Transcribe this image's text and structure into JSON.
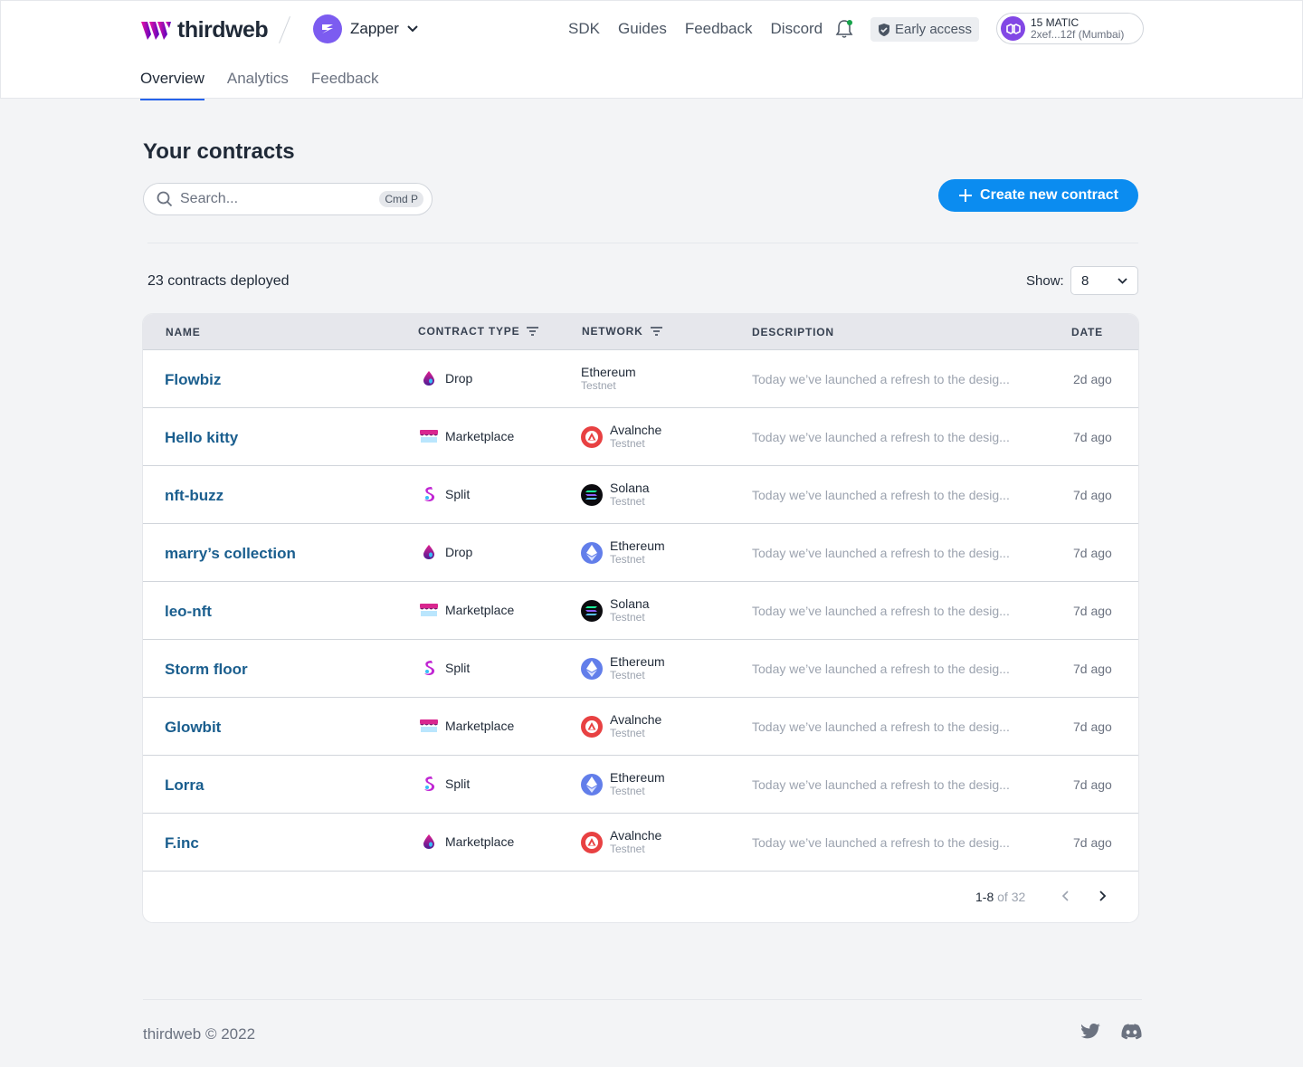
{
  "brand": {
    "name": "thirdweb",
    "accent": "#0b8cf0",
    "logo_color": "#c026d3"
  },
  "project": {
    "name": "Zapper"
  },
  "topnav": [
    {
      "label": "SDK"
    },
    {
      "label": "Guides"
    },
    {
      "label": "Feedback"
    },
    {
      "label": "Discord"
    }
  ],
  "badge": {
    "label": "Early access"
  },
  "wallet": {
    "amount": "15 MATIC",
    "address": "2xef...12f (Mumbai)"
  },
  "subnav": [
    {
      "label": "Overview",
      "active": true
    },
    {
      "label": "Analytics",
      "active": false
    },
    {
      "label": "Feedback",
      "active": false
    }
  ],
  "main": {
    "title": "Your contracts",
    "search_placeholder": "Search...",
    "search_shortcut": "Cmd P",
    "create_label": "Create new contract",
    "count_label": "23 contracts deployed",
    "show_label": "Show:",
    "show_value": "8"
  },
  "table": {
    "columns": [
      "NAME",
      "CONTRACT TYPE",
      "NETWORK",
      "DESCRIPTION",
      "DATE"
    ],
    "rows": [
      {
        "name": "Flowbiz",
        "type": "Drop",
        "type_icon": "drop-icon",
        "network": "Ethereum",
        "network_sub": "Testnet",
        "network_icon": "",
        "description": "Today we’ve launched a refresh to the desig...",
        "date": "2d ago"
      },
      {
        "name": "Hello kitty",
        "type": "Marketplace",
        "type_icon": "marketplace-icon",
        "network": "Avalnche",
        "network_sub": "Testnet",
        "network_icon": "avalanche-icon",
        "description": "Today we’ve launched a refresh to the desig...",
        "date": "7d ago"
      },
      {
        "name": "nft-buzz",
        "type": "Split",
        "type_icon": "split-icon",
        "network": "Solana",
        "network_sub": "Testnet",
        "network_icon": "solana-icon",
        "description": "Today we’ve launched a refresh to the desig...",
        "date": "7d ago"
      },
      {
        "name": "marry’s collection",
        "type": "Drop",
        "type_icon": "drop-icon",
        "network": "Ethereum",
        "network_sub": "Testnet",
        "network_icon": "ethereum-icon",
        "description": "Today we’ve launched a refresh to the desig...",
        "date": "7d ago"
      },
      {
        "name": "leo-nft",
        "type": "Marketplace",
        "type_icon": "marketplace-icon",
        "network": "Solana",
        "network_sub": "Testnet",
        "network_icon": "solana-icon",
        "description": "Today we’ve launched a refresh to the desig...",
        "date": "7d ago"
      },
      {
        "name": "Storm floor",
        "type": "Split",
        "type_icon": "split-icon",
        "network": "Ethereum",
        "network_sub": "Testnet",
        "network_icon": "ethereum-icon",
        "description": "Today we’ve launched a refresh to the desig...",
        "date": "7d ago"
      },
      {
        "name": "Glowbit",
        "type": "Marketplace",
        "type_icon": "marketplace-icon",
        "network": "Avalnche",
        "network_sub": "Testnet",
        "network_icon": "avalanche-icon",
        "description": "Today we’ve launched a refresh to the desig...",
        "date": "7d ago"
      },
      {
        "name": "Lorra",
        "type": "Split",
        "type_icon": "split-icon",
        "network": "Ethereum",
        "network_sub": "Testnet",
        "network_icon": "ethereum-icon",
        "description": "Today we’ve launched a refresh to the desig...",
        "date": "7d ago"
      },
      {
        "name": "F.inc",
        "type": "Marketplace",
        "type_icon": "drop-icon",
        "network": "Avalnche",
        "network_sub": "Testnet",
        "network_icon": "avalanche-icon",
        "description": "Today we’ve launched a refresh to the desig...",
        "date": "7d ago"
      }
    ],
    "pagination": {
      "range": "1-8",
      "total": "of 32"
    }
  },
  "footer": {
    "copyright": "thirdweb © 2022"
  }
}
